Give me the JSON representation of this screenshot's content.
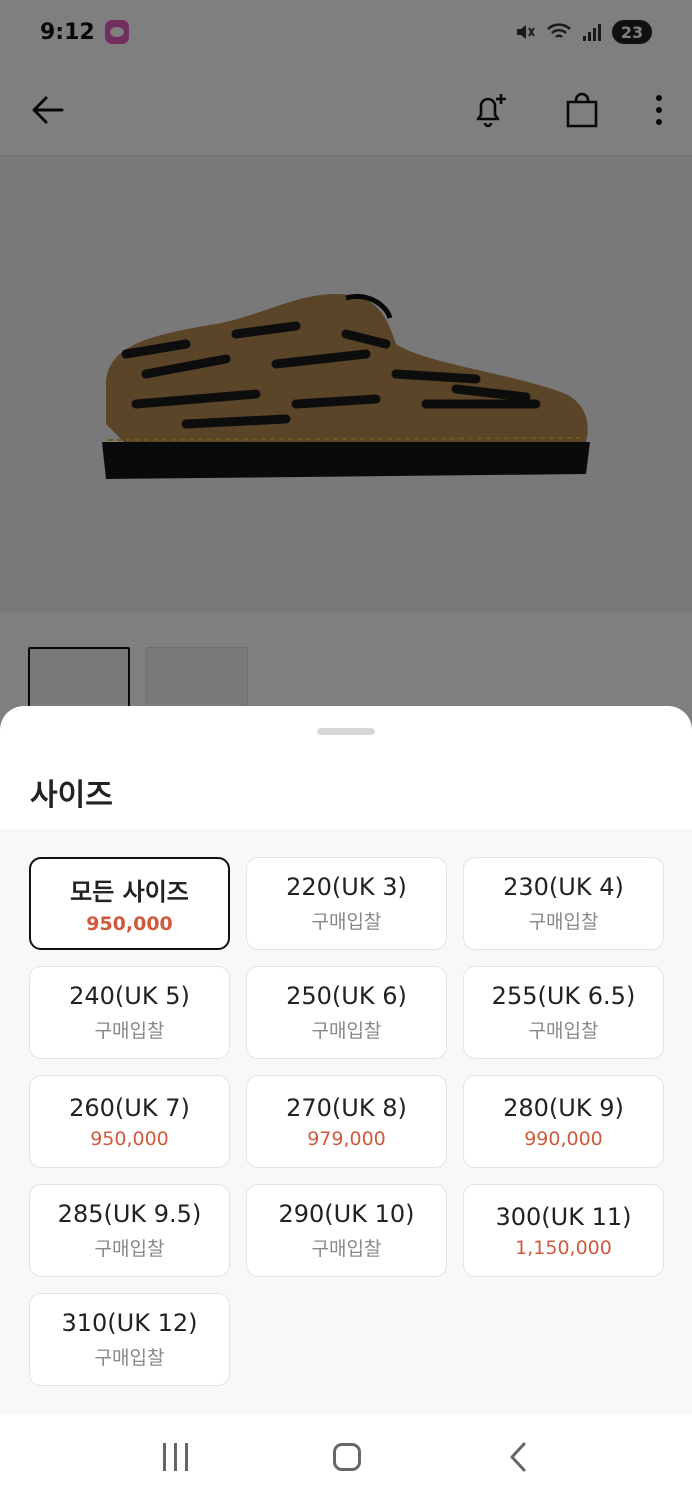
{
  "status_bar": {
    "time": "9:12",
    "battery": "23"
  },
  "header": {
    "back_icon": "arrow-left-icon",
    "alert_icon": "bell-plus-icon",
    "cart_icon": "shopping-bag-icon",
    "more_icon": "more-vertical-icon"
  },
  "sheet": {
    "title": "사이즈",
    "sizes": [
      {
        "label": "모든 사이즈",
        "price": "950,000",
        "selected": true
      },
      {
        "label": "220(UK 3)",
        "price": "구매입찰"
      },
      {
        "label": "230(UK 4)",
        "price": "구매입찰"
      },
      {
        "label": "240(UK 5)",
        "price": "구매입찰"
      },
      {
        "label": "250(UK 6)",
        "price": "구매입찰"
      },
      {
        "label": "255(UK 6.5)",
        "price": "구매입찰"
      },
      {
        "label": "260(UK 7)",
        "price": "950,000"
      },
      {
        "label": "270(UK 8)",
        "price": "979,000"
      },
      {
        "label": "280(UK 9)",
        "price": "990,000"
      },
      {
        "label": "285(UK 9.5)",
        "price": "구매입찰"
      },
      {
        "label": "290(UK 10)",
        "price": "구매입찰"
      },
      {
        "label": "300(UK 11)",
        "price": "1,150,000"
      },
      {
        "label": "310(UK 12)",
        "price": "구매입찰"
      }
    ]
  },
  "colors": {
    "price": "#d05a3e",
    "bid": "#888888",
    "selected_border": "#111111"
  }
}
